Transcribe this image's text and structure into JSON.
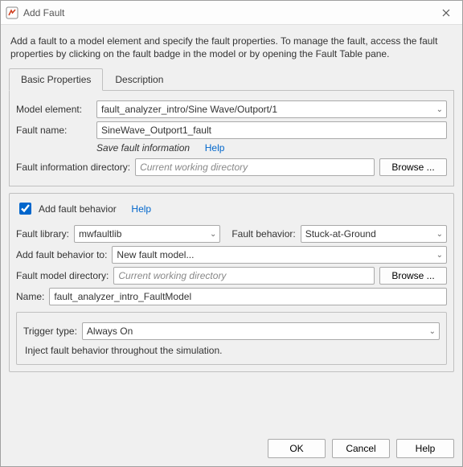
{
  "window": {
    "title": "Add Fault",
    "intro": "Add a fault to a model element and specify the fault properties. To manage the fault, access the fault properties by clicking on the fault badge in the model or by opening the Fault Table pane."
  },
  "tabs": [
    "Basic Properties",
    "Description"
  ],
  "bp": {
    "model_element_label": "Model element:",
    "model_element_value": "fault_analyzer_intro/Sine Wave/Outport/1",
    "fault_name_label": "Fault name:",
    "fault_name_value": "SineWave_Outport1_fault",
    "save_note": "Save fault information",
    "help_label": "Help",
    "fi_dir_label": "Fault information directory:",
    "fi_dir_placeholder": "Current working directory",
    "browse_label": "Browse ..."
  },
  "behavior": {
    "add_label": "Add fault behavior",
    "help_label": "Help",
    "fault_library_label": "Fault library:",
    "fault_library_value": "mwfaultlib",
    "fault_behavior_label": "Fault behavior:",
    "fault_behavior_value": "Stuck-at-Ground",
    "add_to_label": "Add fault behavior to:",
    "add_to_value": "New fault model...",
    "fm_dir_label": "Fault model directory:",
    "fm_dir_placeholder": "Current working directory",
    "browse_label": "Browse ...",
    "name_label": "Name:",
    "name_value": "fault_analyzer_intro_FaultModel",
    "trigger_type_label": "Trigger type:",
    "trigger_type_value": "Always On",
    "trigger_desc": "Inject fault behavior throughout the simulation."
  },
  "footer": {
    "ok": "OK",
    "cancel": "Cancel",
    "help": "Help"
  }
}
